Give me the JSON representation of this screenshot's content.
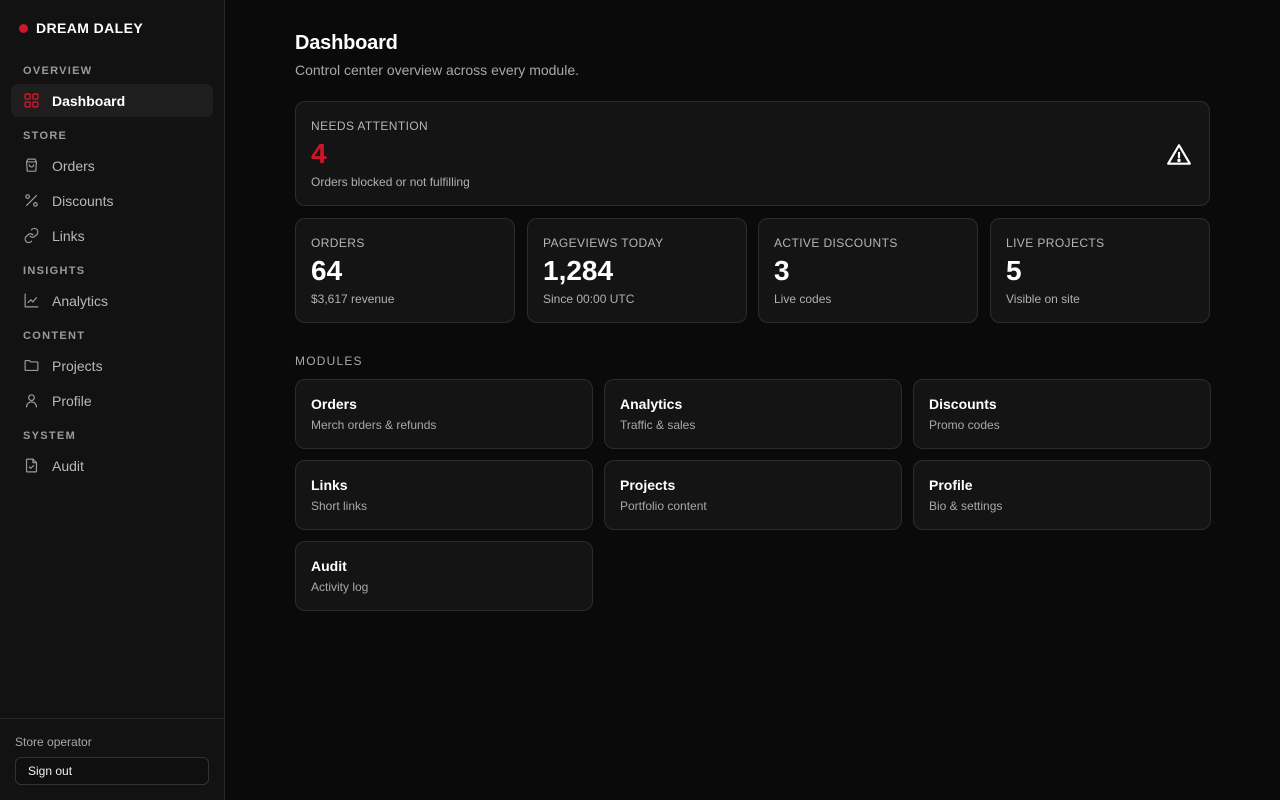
{
  "brand": {
    "name": "DREAM DALEY",
    "accent": "#d0142c"
  },
  "sidebar": {
    "sections": [
      {
        "heading": "OVERVIEW",
        "items": [
          {
            "label": "Dashboard",
            "icon": "grid-icon",
            "active": true
          }
        ]
      },
      {
        "heading": "STORE",
        "items": [
          {
            "label": "Orders",
            "icon": "bag-icon"
          },
          {
            "label": "Discounts",
            "icon": "percent-icon"
          },
          {
            "label": "Links",
            "icon": "link-icon"
          }
        ]
      },
      {
        "heading": "INSIGHTS",
        "items": [
          {
            "label": "Analytics",
            "icon": "chart-line-icon"
          }
        ]
      },
      {
        "heading": "CONTENT",
        "items": [
          {
            "label": "Projects",
            "icon": "folder-icon"
          },
          {
            "label": "Profile",
            "icon": "user-icon"
          }
        ]
      },
      {
        "heading": "SYSTEM",
        "items": [
          {
            "label": "Audit",
            "icon": "file-check-icon"
          }
        ]
      }
    ],
    "footer": {
      "role": "Store operator",
      "signout_label": "Sign out"
    }
  },
  "main": {
    "title": "Dashboard",
    "subtitle": "Control center overview across every module.",
    "attention": {
      "label": "NEEDS ATTENTION",
      "value": "4",
      "sub": "Orders blocked or not fulfilling",
      "icon": "warning-icon"
    },
    "kpis": [
      {
        "label": "ORDERS",
        "value": "64",
        "sub": "$3,617 revenue"
      },
      {
        "label": "PAGEVIEWS TODAY",
        "value": "1,284",
        "sub": "Since 00:00 UTC"
      },
      {
        "label": "ACTIVE DISCOUNTS",
        "value": "3",
        "sub": "Live codes"
      },
      {
        "label": "LIVE PROJECTS",
        "value": "5",
        "sub": "Visible on site"
      }
    ],
    "modules_heading": "MODULES",
    "modules": [
      {
        "title": "Orders",
        "desc": "Merch orders & refunds"
      },
      {
        "title": "Analytics",
        "desc": "Traffic & sales"
      },
      {
        "title": "Discounts",
        "desc": "Promo codes"
      },
      {
        "title": "Links",
        "desc": "Short links"
      },
      {
        "title": "Projects",
        "desc": "Portfolio content"
      },
      {
        "title": "Profile",
        "desc": "Bio & settings"
      },
      {
        "title": "Audit",
        "desc": "Activity log"
      }
    ]
  }
}
